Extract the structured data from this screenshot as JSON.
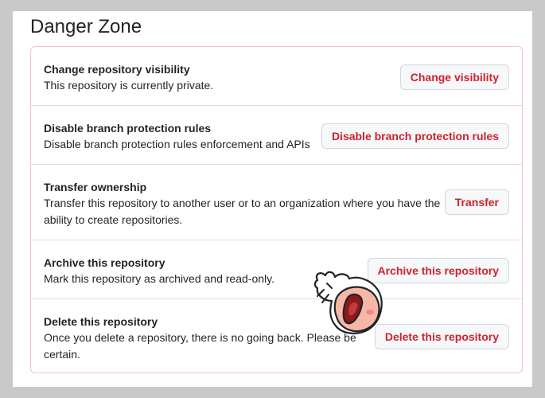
{
  "header": {
    "title": "Danger Zone"
  },
  "rows": [
    {
      "title": "Change repository visibility",
      "description": "This repository is currently private.",
      "button_label": "Change visibility"
    },
    {
      "title": "Disable branch protection rules",
      "description": "Disable branch protection rules enforcement and APIs",
      "button_label": "Disable branch protection rules"
    },
    {
      "title": "Transfer ownership",
      "description_line1": "Transfer this repository to another user or to an organization where you have the",
      "description_line2": "ability to create repositories.",
      "button_label": "Transfer"
    },
    {
      "title": "Archive this repository",
      "description": "Mark this repository as archived and read-only.",
      "button_label": "Archive this repository"
    },
    {
      "title": "Delete this repository",
      "description_line1": "Once you delete a repository, there is no going back. Please be",
      "description_line2": "certain.",
      "button_label": "Delete this repository"
    }
  ],
  "colors": {
    "danger": "#cf222e",
    "border": "#f5c2c7"
  },
  "sticker": {
    "icon": "screaming-peach-sticker-icon"
  }
}
